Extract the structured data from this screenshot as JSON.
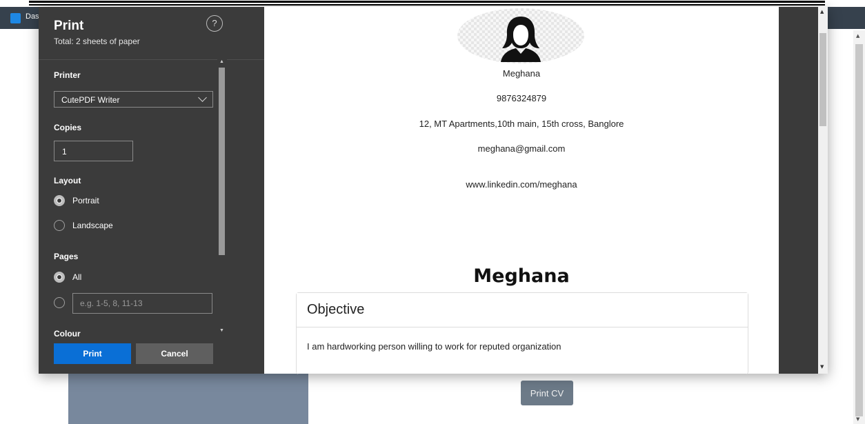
{
  "browser": {
    "tab_title": "Das"
  },
  "background_page": {
    "print_cv_button": "Print CV"
  },
  "print_panel": {
    "title": "Print",
    "subtitle": "Total: 2 sheets of paper",
    "help_icon": "?",
    "printer": {
      "label": "Printer",
      "value": "CutePDF Writer"
    },
    "copies": {
      "label": "Copies",
      "value": "1"
    },
    "layout": {
      "label": "Layout",
      "options": [
        "Portrait",
        "Landscape"
      ],
      "selected": "Portrait"
    },
    "pages": {
      "label": "Pages",
      "options": [
        "All"
      ],
      "selected": "All",
      "range_placeholder": "e.g. 1-5, 8, 11-13"
    },
    "colour_label": "Colour",
    "buttons": {
      "print": "Print",
      "cancel": "Cancel"
    }
  },
  "preview": {
    "contact": {
      "name": "Meghana",
      "phone": "9876324879",
      "address": "12, MT Apartments,10th main, 15th cross, Banglore",
      "email": "meghana@gmail.com",
      "linkedin": "www.linkedin.com/meghana"
    },
    "heading_name": "Meghana",
    "objective": {
      "title": "Objective",
      "text": "I am hardworking person willing to work for reputed organization"
    }
  },
  "colors": {
    "panel_bg": "#3b3b3b",
    "print_button": "#0a6fd6",
    "cancel_button": "#5f5f5f",
    "preview_bg": "#3a3a3a",
    "topbar": "#36414d"
  }
}
